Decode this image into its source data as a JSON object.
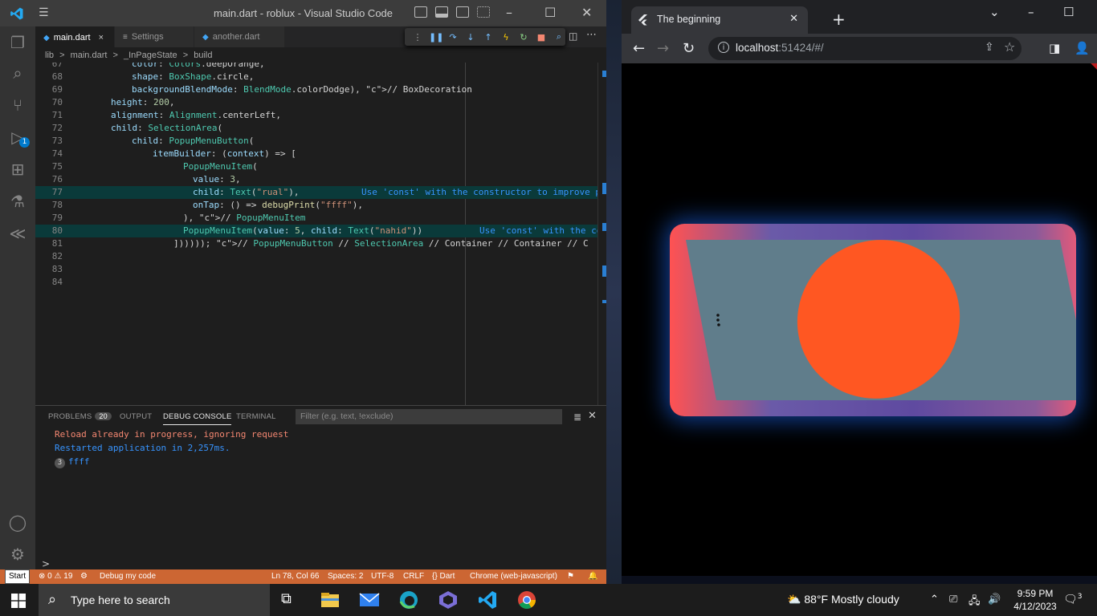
{
  "vscode": {
    "title": "main.dart - roblux - Visual Studio Code",
    "tabs": [
      {
        "label": "main.dart",
        "close": "×"
      },
      {
        "label": "Settings"
      },
      {
        "label": "another.dart"
      }
    ],
    "breadcrumb": [
      "lib",
      ">",
      "main.dart",
      ">",
      "_InPageState",
      ">",
      "build"
    ],
    "activity_badges": {
      "debug": "1"
    },
    "lines": [
      {
        "n": "67",
        "code": "color: Colors.deepOrange,"
      },
      {
        "n": "68",
        "code": "shape: BoxShape.circle,"
      },
      {
        "n": "69",
        "code": "backgroundBlendMode: BlendMode.colorDodge), // BoxDecoration"
      },
      {
        "n": "70",
        "code": "height: 200,"
      },
      {
        "n": "71",
        "code": "alignment: Alignment.centerLeft,"
      },
      {
        "n": "72",
        "code": "child: SelectionArea("
      },
      {
        "n": "73",
        "code": "child: PopupMenuButton("
      },
      {
        "n": "74",
        "code": "itemBuilder: (context) => ["
      },
      {
        "n": "75",
        "code": "PopupMenuItem("
      },
      {
        "n": "76",
        "code": "value: 3,"
      },
      {
        "n": "77",
        "code": "child: Text(\"rual\"),",
        "hint": "Use 'const' with the constructor to improve per"
      },
      {
        "n": "78",
        "code": "onTap: () => debugPrint(\"ffff\"),"
      },
      {
        "n": "79",
        "code": "), // PopupMenuItem"
      },
      {
        "n": "80",
        "code": "PopupMenuItem(value: 5, child: Text(\"nahid\"))",
        "hint": "Use 'const' with the cons"
      },
      {
        "n": "81",
        "code": "]))))); // PopupMenuButton // SelectionArea // Container // Container // C"
      },
      {
        "n": "82",
        "code": ""
      },
      {
        "n": "83",
        "code": ""
      },
      {
        "n": "84",
        "code": ""
      }
    ],
    "panel": {
      "tabs": [
        "PROBLEMS",
        "OUTPUT",
        "DEBUG CONSOLE",
        "TERMINAL"
      ],
      "problems_count": "20",
      "filter_placeholder": "Filter (e.g. text, !exclude)",
      "console": [
        {
          "text": "Reload already in progress, ignoring request",
          "color": "#f48771"
        },
        {
          "text": "Restarted application in 2,257ms.",
          "color": "#3794ff"
        },
        {
          "count": "3",
          "text": "ffff",
          "color": "#3794ff"
        }
      ],
      "prompt": ">"
    },
    "status": {
      "problems": "0",
      "warnings": "19",
      "debug": "Debug my code",
      "position": "Ln 78, Col 66",
      "spaces": "Spaces: 2",
      "encoding": "UTF-8",
      "eol": "CRLF",
      "lang": "Dart",
      "device": "Chrome (web-javascript)"
    },
    "tooltip": "Start",
    "accent": "#cc6633"
  },
  "chrome": {
    "tab_title": "The beginning",
    "url_host": "localhost",
    "url_rest": ":51424/#/",
    "new_tab": "+"
  },
  "taskbar": {
    "search_placeholder": "Type here to search",
    "weather": "88°F  Mostly cloudy",
    "time": "9:59 PM",
    "date": "4/12/2023",
    "notifications": "3"
  }
}
